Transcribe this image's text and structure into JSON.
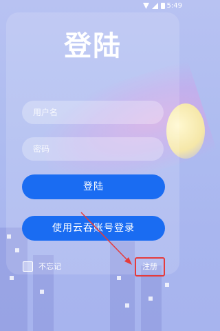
{
  "status_bar": {
    "time": "5:49"
  },
  "title": "登陆",
  "username": {
    "placeholder": "用户名",
    "value": ""
  },
  "password": {
    "placeholder": "密码",
    "value": ""
  },
  "buttons": {
    "login": "登陆",
    "yun_login": "使用云吞账号登录"
  },
  "remember_label": "不忘记",
  "register_label": "注册",
  "colors": {
    "primary_button": "#1a6cf2",
    "highlight_box": "#e53b3b"
  }
}
